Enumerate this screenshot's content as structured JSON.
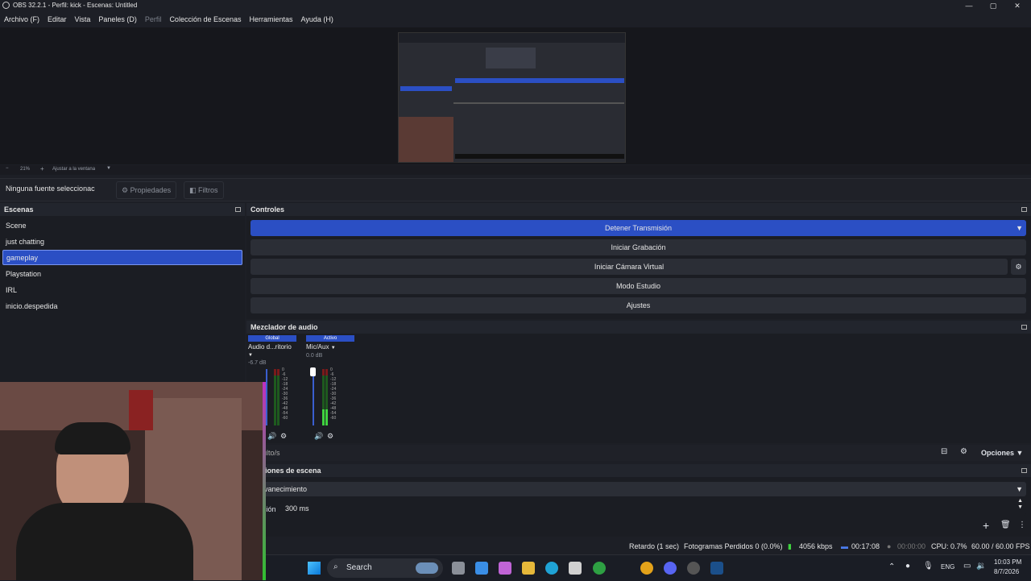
{
  "window": {
    "title": "OBS 32.2.1 - Perfil: kick - Escenas: Untitled"
  },
  "menu": {
    "items": [
      "Archivo (F)",
      "Editar",
      "Vista",
      "Paneles (D)",
      "Perfil",
      "Colección de Escenas",
      "Herramientas",
      "Ayuda (H)"
    ]
  },
  "zoom": {
    "minus": "−",
    "value": "21%",
    "plus": "+",
    "fit": "Ajustar a la ventana"
  },
  "source_bar": {
    "no_source": "Ninguna fuente seleccionac",
    "properties": "Propiedades",
    "filters": "Filtros"
  },
  "scenes": {
    "title": "Escenas",
    "items": [
      "Scene",
      "just chatting",
      "gameplay",
      "Playstation",
      "IRL",
      "inicio.despedida"
    ],
    "selected": "gameplay"
  },
  "controls": {
    "title": "Controles",
    "stop_stream": "Detener Transmisión",
    "start_recording": "Iniciar Grabación",
    "start_virtual_cam": "Iniciar Cámara Virtual",
    "studio_mode": "Modo Estudio",
    "settings": "Ajustes"
  },
  "mixer": {
    "title": "Mezclador de audio",
    "channels": [
      {
        "tag": "Global",
        "name": "Audio d...ritorio",
        "db": "-6.7 dB"
      },
      {
        "tag": "Activo",
        "name": "Mic/Aux",
        "db": "0.0 dB"
      }
    ],
    "scale": [
      "0",
      "-6",
      "-12",
      "-18",
      "-24",
      "-30",
      "-36",
      "-42",
      "-48",
      "-54",
      "-60"
    ],
    "hidden": "ulto/s",
    "options": "Opciones"
  },
  "transitions": {
    "title": "nsiciones de escena",
    "type": "vanecimiento",
    "duration_label": "ción",
    "duration_value": "300 ms"
  },
  "status": {
    "delay": "Retardo (1 sec)",
    "dropped": "Fotogramas Perdidos 0 (0.0%)",
    "bitrate": "4056 kbps",
    "stream_time": "00:17:08",
    "rec_time": "00:00:00",
    "cpu": "CPU: 0.7%",
    "fps": "60.00 / 60.00 FPS"
  },
  "taskbar": {
    "search": "Search",
    "lang": "ENG",
    "time": "10:03 PM",
    "date": "8/7/2026"
  },
  "colors": {
    "accent": "#2b4fc4",
    "panel": "#1b1d23",
    "header": "#22252d"
  }
}
